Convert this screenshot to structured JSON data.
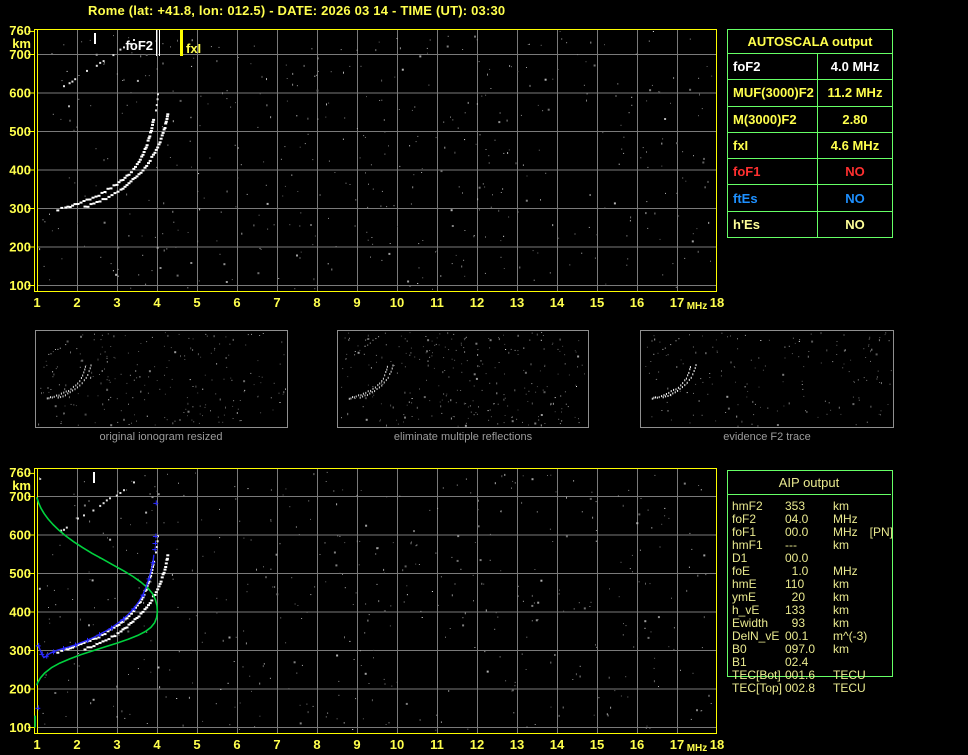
{
  "title": "Rome (lat: +41.8, lon: 012.5) - DATE: 2026 03 14 - TIME (UT): 03:30",
  "colors": {
    "title_yellow": "#ffff4d",
    "border_yellow": "#fdfd00",
    "axis_yellow": "#ffff4d",
    "grid_gray": "#7a7a7a",
    "trace_white": "#ffffff",
    "profile_green": "#00d23e",
    "restored_blue": "#2a2aff",
    "table_green": "#66ff66",
    "red": "#ff3030",
    "ftes_blue": "#1e90ff",
    "pale_yellow": "#ffff99",
    "aip_text": "#e9e98f",
    "caption_gray": "#9c9c9c",
    "thumb_border": "#8f8f8f"
  },
  "autoscala_table": {
    "header": "AUTOSCALA output",
    "rows": [
      {
        "label": "foF2",
        "value": "4.0 MHz",
        "color": "#ffffff"
      },
      {
        "label": "MUF(3000)F2",
        "value": "11.2 MHz",
        "color": "#ffff4d"
      },
      {
        "label": "M(3000)F2",
        "value": "2.80",
        "color": "#ffff4d"
      },
      {
        "label": "fxI",
        "value": "4.6 MHz",
        "color": "#ffff4d"
      },
      {
        "label": "foF1",
        "value": "NO",
        "color": "#ff3030"
      },
      {
        "label": "ftEs",
        "value": "NO",
        "color": "#1e90ff"
      },
      {
        "label": "h'Es",
        "value": "NO",
        "color": "#ffff99"
      }
    ]
  },
  "aip_table": {
    "header": "AIP output",
    "rows": [
      {
        "label": "hmF2",
        "value": "353",
        "unit": "km",
        "extra": ""
      },
      {
        "label": "foF2",
        "value": "04.0",
        "unit": "MHz",
        "extra": ""
      },
      {
        "label": "foF1",
        "value": "00.0",
        "unit": "MHz",
        "extra": "[PN]"
      },
      {
        "label": "hmF1",
        "value": "---",
        "unit": "km",
        "extra": ""
      },
      {
        "label": "D1",
        "value": "00.0",
        "unit": "",
        "extra": ""
      },
      {
        "label": "foE",
        "value": "  1.0",
        "unit": "MHz",
        "extra": ""
      },
      {
        "label": "hmE",
        "value": "110",
        "unit": "km",
        "extra": ""
      },
      {
        "label": "ymE",
        "value": "  20",
        "unit": "km",
        "extra": ""
      },
      {
        "label": "h_vE",
        "value": "133",
        "unit": "km",
        "extra": ""
      },
      {
        "label": "Ewidth",
        "value": "  93",
        "unit": "km",
        "extra": ""
      },
      {
        "label": "DelN_vE",
        "value": "00.1",
        "unit": "m^(-3)",
        "extra": ""
      },
      {
        "label": "B0",
        "value": "097.0",
        "unit": "km",
        "extra": ""
      },
      {
        "label": "B1",
        "value": "02.4",
        "unit": "",
        "extra": ""
      },
      {
        "label": "TEC[Bot]",
        "value": "001.6",
        "unit": "TECU",
        "extra": ""
      },
      {
        "label": "TEC[Top]",
        "value": "002.8",
        "unit": "TECU",
        "extra": ""
      }
    ]
  },
  "thumbnails": [
    {
      "caption": "original ionogram resized"
    },
    {
      "caption": "eliminate multiple reflections"
    },
    {
      "caption": "evidence F2 trace"
    }
  ],
  "axes": {
    "x_ticks": [
      "1",
      "2",
      "3",
      "4",
      "5",
      "6",
      "7",
      "8",
      "9",
      "10",
      "11",
      "12",
      "13",
      "14",
      "15",
      "16",
      "17",
      "18"
    ],
    "x_unit": "MHz",
    "y_ticks": [
      "760",
      "700",
      "600",
      "500",
      "400",
      "300",
      "200",
      "100"
    ],
    "y_tick_values": [
      760,
      700,
      600,
      500,
      400,
      300,
      200,
      100
    ],
    "y_unit": "km",
    "x_range": [
      1,
      18
    ],
    "y_range": [
      100,
      760
    ]
  },
  "markers": {
    "foF2_label": "foF2",
    "foF2_mhz": 4.0,
    "fxI_label": "fxI",
    "fxI_mhz": 4.6
  },
  "chart_data": {
    "type": "scatter",
    "title": "ionogram virtual height vs frequency",
    "xlabel": "MHz",
    "ylabel": "km",
    "xlim": [
      1,
      18
    ],
    "ylim": [
      100,
      760
    ],
    "grid": true,
    "units": [
      "MHz",
      "km"
    ],
    "traces": {
      "o_branch": [
        [
          1.52,
          295
        ],
        [
          1.62,
          298
        ],
        [
          1.72,
          301
        ],
        [
          1.83,
          304
        ],
        [
          1.95,
          308
        ],
        [
          2.1,
          314
        ],
        [
          2.25,
          320
        ],
        [
          2.4,
          327
        ],
        [
          2.55,
          334
        ],
        [
          2.7,
          343
        ],
        [
          2.85,
          352
        ],
        [
          3.0,
          362
        ],
        [
          3.15,
          374
        ],
        [
          3.3,
          388
        ],
        [
          3.42,
          402
        ],
        [
          3.55,
          420
        ],
        [
          3.65,
          438
        ],
        [
          3.73,
          458
        ],
        [
          3.8,
          480
        ],
        [
          3.86,
          502
        ],
        [
          3.9,
          522
        ],
        [
          3.93,
          540
        ]
      ],
      "x_branch": [
        [
          2.2,
          303
        ],
        [
          2.35,
          308
        ],
        [
          2.5,
          314
        ],
        [
          2.65,
          321
        ],
        [
          2.8,
          329
        ],
        [
          2.95,
          338
        ],
        [
          3.1,
          348
        ],
        [
          3.25,
          360
        ],
        [
          3.4,
          373
        ],
        [
          3.55,
          388
        ],
        [
          3.7,
          405
        ],
        [
          3.83,
          424
        ],
        [
          3.95,
          444
        ],
        [
          4.05,
          465
        ],
        [
          4.13,
          487
        ],
        [
          4.2,
          510
        ],
        [
          4.25,
          532
        ],
        [
          4.28,
          552
        ]
      ],
      "echo": [
        [
          1.58,
          612
        ],
        [
          1.72,
          622
        ],
        [
          1.86,
          632
        ],
        [
          2.0,
          642
        ],
        [
          2.15,
          652
        ],
        [
          2.3,
          662
        ],
        [
          2.47,
          673
        ],
        [
          2.64,
          684
        ],
        [
          2.8,
          694
        ],
        [
          2.97,
          706
        ],
        [
          3.15,
          718
        ],
        [
          3.32,
          731
        ],
        [
          3.48,
          744
        ]
      ],
      "o_fragments": [
        [
          3.95,
          556
        ],
        [
          3.97,
          570
        ],
        [
          3.99,
          585
        ],
        [
          4.0,
          598
        ]
      ],
      "profile_green": [
        [
          1.0,
          695
        ],
        [
          1.04,
          682
        ],
        [
          1.1,
          668
        ],
        [
          1.18,
          654
        ],
        [
          1.28,
          640
        ],
        [
          1.4,
          626
        ],
        [
          1.55,
          611
        ],
        [
          1.72,
          596
        ],
        [
          1.92,
          581
        ],
        [
          2.14,
          566
        ],
        [
          2.38,
          551
        ],
        [
          2.64,
          536
        ],
        [
          2.9,
          521
        ],
        [
          3.16,
          506
        ],
        [
          3.4,
          491
        ],
        [
          3.6,
          476
        ],
        [
          3.77,
          461
        ],
        [
          3.89,
          446
        ],
        [
          3.96,
          431
        ],
        [
          4.0,
          415
        ],
        [
          4.01,
          399
        ],
        [
          3.99,
          384
        ],
        [
          3.94,
          371
        ],
        [
          3.85,
          359
        ],
        [
          3.71,
          348
        ],
        [
          3.52,
          338
        ],
        [
          3.28,
          328
        ],
        [
          3.0,
          318
        ],
        [
          2.7,
          308
        ],
        [
          2.4,
          298
        ],
        [
          2.1,
          288
        ],
        [
          1.82,
          277
        ],
        [
          1.57,
          266
        ],
        [
          1.36,
          254
        ],
        [
          1.2,
          241
        ],
        [
          1.09,
          228
        ],
        [
          1.02,
          216
        ],
        [
          1.0,
          210
        ]
      ],
      "profile_green_e": [
        [
          0.95,
          128
        ],
        [
          0.95,
          100
        ]
      ],
      "restored_blue": [
        [
          1.03,
          312
        ],
        [
          1.07,
          302
        ],
        [
          1.12,
          290
        ],
        [
          1.17,
          280
        ],
        [
          1.23,
          284
        ],
        [
          1.3,
          290
        ],
        [
          1.4,
          295
        ],
        [
          1.52,
          300
        ],
        [
          1.65,
          304
        ],
        [
          1.8,
          308
        ],
        [
          1.95,
          313
        ],
        [
          2.1,
          319
        ],
        [
          2.25,
          325
        ],
        [
          2.4,
          332
        ],
        [
          2.55,
          340
        ],
        [
          2.7,
          348
        ],
        [
          2.85,
          357
        ],
        [
          3.0,
          368
        ],
        [
          3.15,
          380
        ],
        [
          3.3,
          394
        ],
        [
          3.42,
          408
        ],
        [
          3.55,
          426
        ],
        [
          3.65,
          444
        ],
        [
          3.73,
          464
        ],
        [
          3.8,
          486
        ],
        [
          3.86,
          508
        ],
        [
          3.9,
          528
        ],
        [
          3.92,
          546
        ]
      ],
      "blue_isolated": [
        [
          3.94,
          562
        ],
        [
          3.95,
          578
        ],
        [
          3.96,
          596
        ],
        [
          3.97,
          682
        ],
        [
          1.02,
          150
        ]
      ]
    }
  }
}
